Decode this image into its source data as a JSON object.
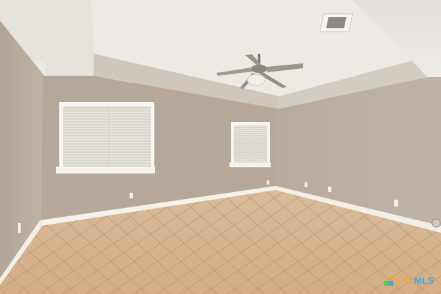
{
  "photo": {
    "subject": "empty-room-interior",
    "colors": {
      "ceiling": "#ebe8e3",
      "tray": "#cdc6bc",
      "wall_left": "#b9ad9e",
      "wall_back": "#b4a898",
      "wall_right": "#b8ad9f",
      "baseboard": "#f3f1ec",
      "floor": "#d6b593",
      "grout": "#b8956f"
    }
  },
  "watermark": {
    "brand_part1": "CTX",
    "brand_part2": "MLS",
    "colors": {
      "primary": "#f2a33a",
      "secondary": "#4aa3d8",
      "tertiary": "#6cbf4a"
    }
  }
}
